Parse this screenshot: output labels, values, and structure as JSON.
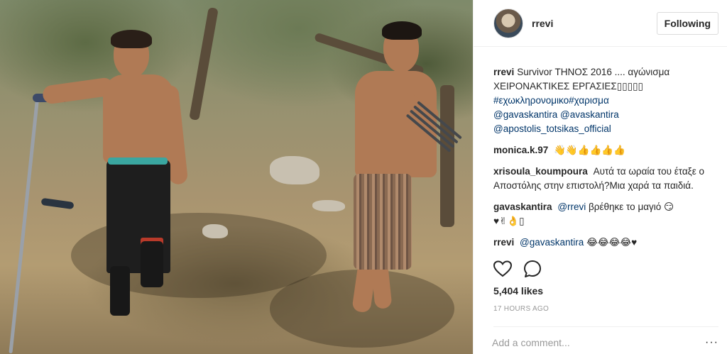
{
  "photo": {
    "alt": ""
  },
  "header": {
    "username": "rrevi",
    "follow_label": "Following"
  },
  "comments": [
    {
      "user": "rrevi",
      "lines": [
        "Survivor ΤΗΝΟΣ 2016 .... αγώνισμα",
        "ΧΕΙΡΟΝΑΚΤΙΚΕΣ ΕΡΓΑΣΙΕΣ▯▯▯▯▯"
      ],
      "hashtags": "#εχωκληρονομικο#χαρισμα",
      "mentions": [
        "@gavaskantira @avaskantira",
        "@apostolis_totsikas_official"
      ]
    },
    {
      "user": "monica.k.97",
      "text": "👋👋👍👍👍👍"
    },
    {
      "user": "xrisoula_koumpoura",
      "text": "Αυτά τα ωραία του έταξε ο Αποστόλης στην επιστολή?Μια χαρά τα παιδιά."
    },
    {
      "user": "gavaskantira",
      "mention": "@rrevi",
      "text": "βρέθηκε το μαγιό 😏",
      "text2": "♥✌👌▯"
    },
    {
      "user": "rrevi",
      "mention": "@gavaskantira",
      "text": "😂😂😂😂♥"
    }
  ],
  "actions": {
    "like_icon": "heart-icon",
    "comment_icon": "comment-bubble-icon"
  },
  "likes": "5,404 likes",
  "time_ago": "17 HOURS AGO",
  "add_comment": {
    "placeholder": "Add a comment...",
    "more": "···"
  },
  "colors": {
    "link": "#003569",
    "text": "#262626",
    "muted": "#999999",
    "border": "#efefef"
  }
}
